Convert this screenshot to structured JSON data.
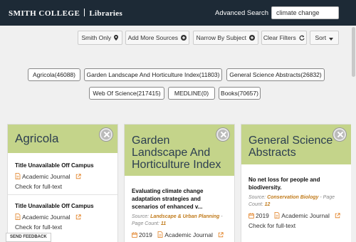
{
  "header": {
    "brand_left": "Smith College",
    "brand_right": "Libraries",
    "advanced_search": "Advanced Search",
    "search_value": "climate change"
  },
  "toolbar": {
    "smith_only": "Smith Only",
    "add_sources": "Add More Sources",
    "narrow_subject": "Narrow By Subject",
    "clear_filters": "Clear Filters",
    "sort": "Sort"
  },
  "facets": [
    "Agricola(46088)",
    "Garden Landscape And Horticulture Index(11803)",
    "General Science Abstracts(26832)",
    "Web Of Science(217415)",
    "MEDLINE(0)",
    "Books(70657)"
  ],
  "cards": [
    {
      "title": "Agricola",
      "results": [
        {
          "title": "Title Unavailable Off Campus",
          "type": "Academic Journal",
          "fulltext": "Check for full-text"
        },
        {
          "title": "Title Unavailable Off Campus",
          "type": "Academic Journal",
          "fulltext": "Check for full-text"
        }
      ]
    },
    {
      "title": "Garden Landscape And Horticulture Index",
      "results": [
        {
          "title": "Evaluating climate change adaptation strategies and scenarios of enhanced v...",
          "source_label": "Source:",
          "source": "Landscape & Urban Planning",
          "page_count_label": "- Page Count:",
          "page_count": "11",
          "year": "2019",
          "type": "Academic Journal"
        }
      ]
    },
    {
      "title": "General Science Abstracts",
      "results": [
        {
          "title": "No net loss for people and biodiversity.",
          "source_label": "Source:",
          "source": "Conservation Biology",
          "page_count_label": "- Page Count:",
          "page_count": "12",
          "year": "2019",
          "type": "Academic Journal",
          "fulltext": "Check for full-text"
        }
      ]
    }
  ],
  "feedback": "SEND FEEDBACK",
  "colors": {
    "header_bg": "#1d2a36",
    "card_head": "#c4d48a",
    "link_orange": "#e07b1a"
  },
  "icons": [
    "search-icon",
    "map-marker-icon",
    "plus-circle-icon",
    "refresh-icon",
    "caret-down-icon",
    "close-icon",
    "calendar-icon",
    "document-icon",
    "external-link-icon"
  ]
}
